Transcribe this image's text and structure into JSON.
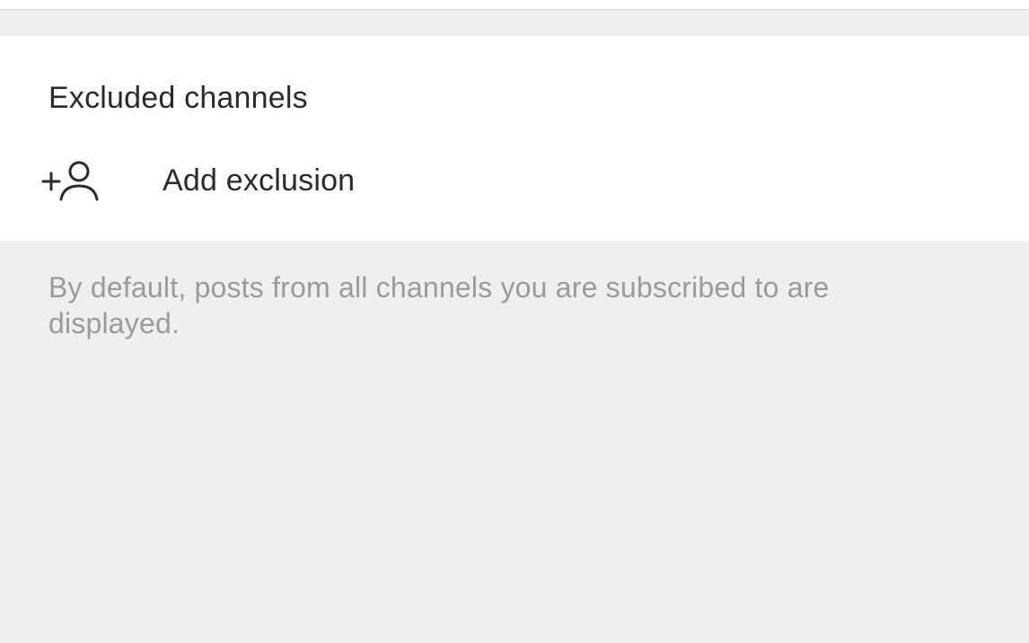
{
  "section": {
    "title": "Excluded channels"
  },
  "actions": {
    "add_exclusion_label": "Add exclusion",
    "add_exclusion_icon": "add-person-icon"
  },
  "helper_text": "By default, posts from all channels you are subscribed to are displayed.",
  "colors": {
    "page_background": "#efefef",
    "card_background": "#ffffff",
    "primary_text": "#2a2a2a",
    "secondary_text": "#9b9b9b"
  }
}
